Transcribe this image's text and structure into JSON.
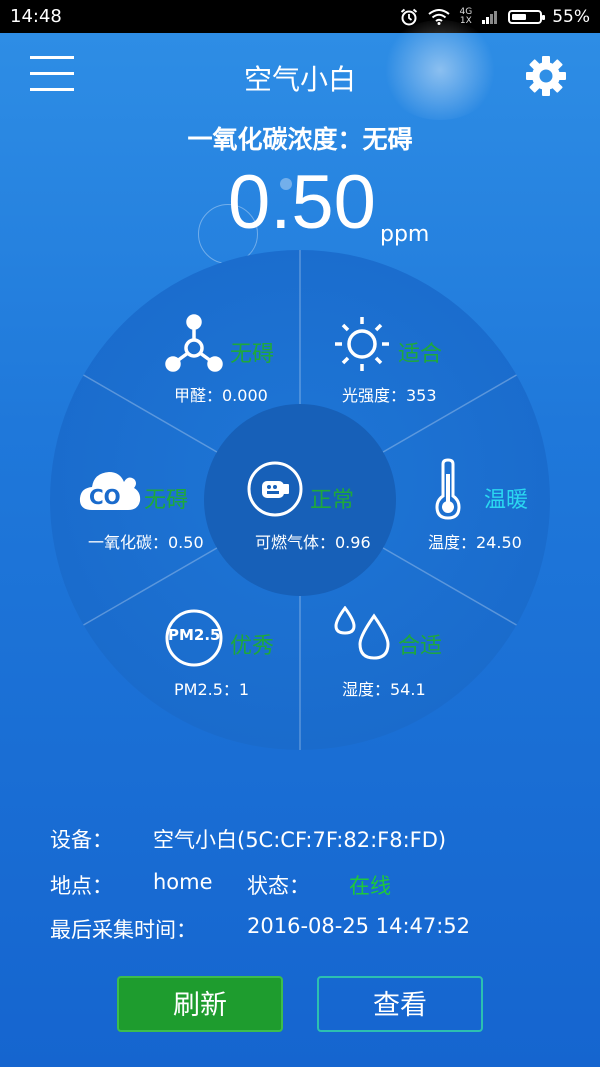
{
  "status_bar": {
    "time": "14:48",
    "network_top": "4G",
    "network_bottom": "1X",
    "battery": "55%",
    "battery_level": 0.55
  },
  "header": {
    "title": "空气小白"
  },
  "co_status": "一氧化碳浓度：无碍",
  "reading": {
    "value": "0.50",
    "unit": "ppm"
  },
  "wheel": {
    "formaldehyde": {
      "status": "无碍",
      "label": "甲醛：0.000"
    },
    "light": {
      "status": "适合",
      "label": "光强度：353"
    },
    "co": {
      "status": "无碍",
      "label": "一氧化碳：0.50",
      "icon_text": "CO"
    },
    "combustible": {
      "status": "正常",
      "label": "可燃气体：0.96"
    },
    "temperature": {
      "status": "温暖",
      "label": "温度：24.50"
    },
    "pm25": {
      "status": "优秀",
      "label": "PM2.5：1",
      "icon_text": "PM2.5"
    },
    "humidity": {
      "status": "合适",
      "label": "湿度：54.1"
    }
  },
  "info": {
    "device_label": "设备：",
    "device_value": "空气小白(5C:CF:7F:82:F8:FD)",
    "location_label": "地点：",
    "location_value": "home",
    "state_label": "状态：",
    "state_value": "在线",
    "time_label": "最后采集时间：",
    "time_value": "2016-08-25 14:47:52"
  },
  "buttons": {
    "refresh": "刷新",
    "view": "查看"
  },
  "colors": {
    "green_status": "#1ea83c",
    "cyan_status": "#2ad7f0",
    "refresh_bg": "#1e9c2e"
  }
}
